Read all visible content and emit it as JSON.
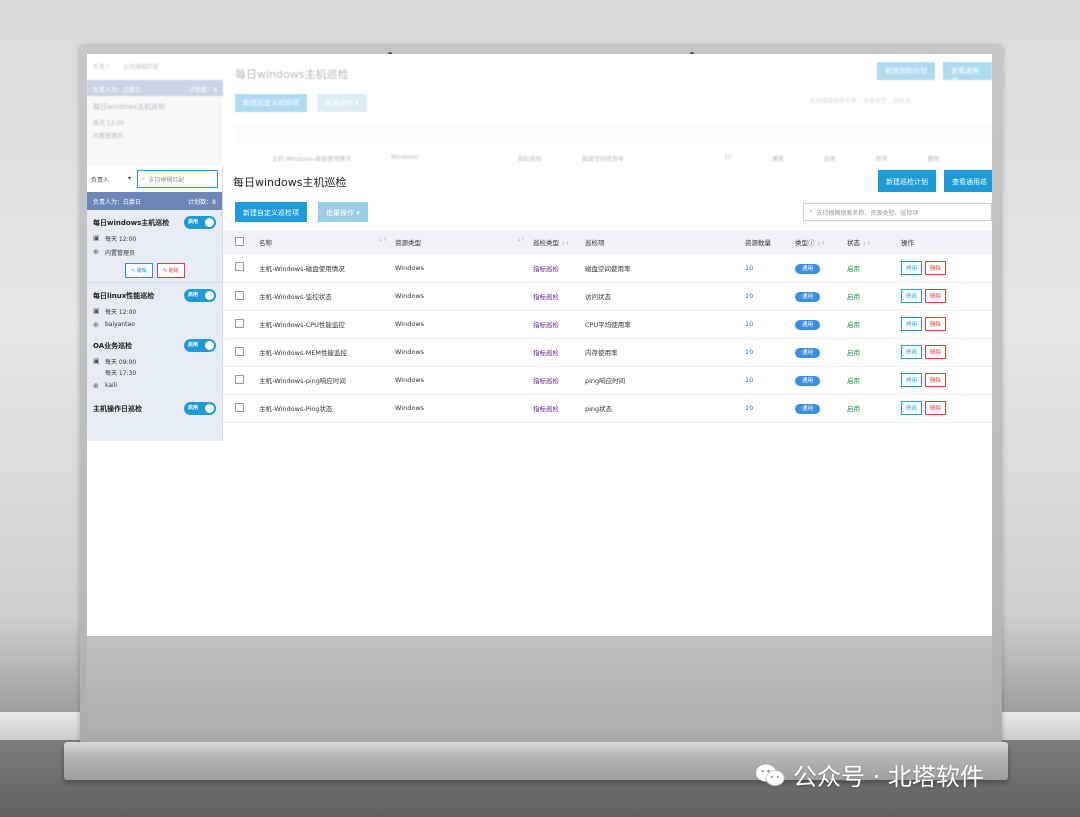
{
  "ghost": {
    "title": "每日windows主机巡检",
    "btn_new_custom": "新建自定义巡检项",
    "btn_batch": "批量操作 ▾",
    "btn_new_plan": "新建巡检计划",
    "btn_view_general": "查看通用巡",
    "search_placeholder": "支持模糊搜索名称、资源类型、巡检项",
    "side_select": "负责人",
    "side_search": "支持模糊匹配",
    "side_bar_left": "负责人为：白爵日",
    "side_bar_right": "计划数：8",
    "side_plan": "每日windows主机巡检",
    "side_line1": "每天 12:00",
    "side_line2": "内置管理员",
    "row": {
      "name": "主机-Windows-磁盘使用情况",
      "type": "Windows",
      "cat": "指标巡检",
      "item": "磁盘空间使用率",
      "count": "10",
      "tag": "通用",
      "status": "启用",
      "stop": "停用",
      "del": "删除"
    }
  },
  "sidebar": {
    "filter_select": "负责人",
    "filter_search_placeholder": "支持模糊匹配",
    "bar_left": "负责人为：白爵日",
    "bar_right": "计划数：8",
    "plans": [
      {
        "title": "每日windows主机巡检",
        "toggle": "启用",
        "line1": "每天 12:00",
        "line2": "内置管理员",
        "edit": "编辑",
        "del": "删除"
      },
      {
        "title": "每日linux性能巡检",
        "toggle": "启用",
        "line1": "每天 12:00",
        "line2": "baiyantao"
      },
      {
        "title": "OA业务巡检",
        "toggle": "启用",
        "line1": "每天 09:00",
        "line1b": "每天 17:30",
        "line2": "kaili"
      },
      {
        "title": "主机操作日巡检",
        "toggle": "启用"
      }
    ]
  },
  "main": {
    "title": "每日windows主机巡检",
    "btn_new_plan": "新建巡检计划",
    "btn_view_general": "查看通用巡",
    "btn_new_custom": "新建自定义巡检项",
    "btn_batch": "批量操作 ▾",
    "search_placeholder": "支持模糊搜索名称、资源类型、巡检项",
    "columns": [
      "名称",
      "资源类型",
      "巡检类型",
      "巡检项",
      "资源数量",
      "类型",
      "状态",
      "操作"
    ],
    "rows": [
      {
        "name": "主机-Windows-磁盘使用情况",
        "type": "Windows",
        "cat": "指标巡检",
        "item": "磁盘空间使用率",
        "count": "10",
        "tag": "通用",
        "status": "启用",
        "stop": "停用",
        "del": "删除"
      },
      {
        "name": "主机-Windows-监控状态",
        "type": "Windows",
        "cat": "指标巡检",
        "item": "访问状态",
        "count": "10",
        "tag": "通用",
        "status": "启用",
        "stop": "停用",
        "del": "删除"
      },
      {
        "name": "主机-Windows-CPU性能监控",
        "type": "Windows",
        "cat": "指标巡检",
        "item": "CPU平均使用率",
        "count": "10",
        "tag": "通用",
        "status": "启用",
        "stop": "停用",
        "del": "删除"
      },
      {
        "name": "主机-Windows-MEM性能监控",
        "type": "Windows",
        "cat": "指标巡检",
        "item": "内存使用率",
        "count": "10",
        "tag": "通用",
        "status": "启用",
        "stop": "停用",
        "del": "删除"
      },
      {
        "name": "主机-Windows-ping响应时间",
        "type": "Windows",
        "cat": "指标巡检",
        "item": "ping响应时间",
        "count": "10",
        "tag": "通用",
        "status": "启用",
        "stop": "停用",
        "del": "删除"
      },
      {
        "name": "主机-Windows-Ping状态",
        "type": "Windows",
        "cat": "指标巡检",
        "item": "ping状态",
        "count": "10",
        "tag": "通用",
        "status": "启用",
        "stop": "停用",
        "del": "删除"
      }
    ]
  },
  "watermark": "公众号 · 北塔软件",
  "colors": {
    "accent": "#1e9bd7",
    "danger": "#e03c3c",
    "sidebar_bar": "#6d86b8",
    "enabled": "#1e9b4a"
  }
}
